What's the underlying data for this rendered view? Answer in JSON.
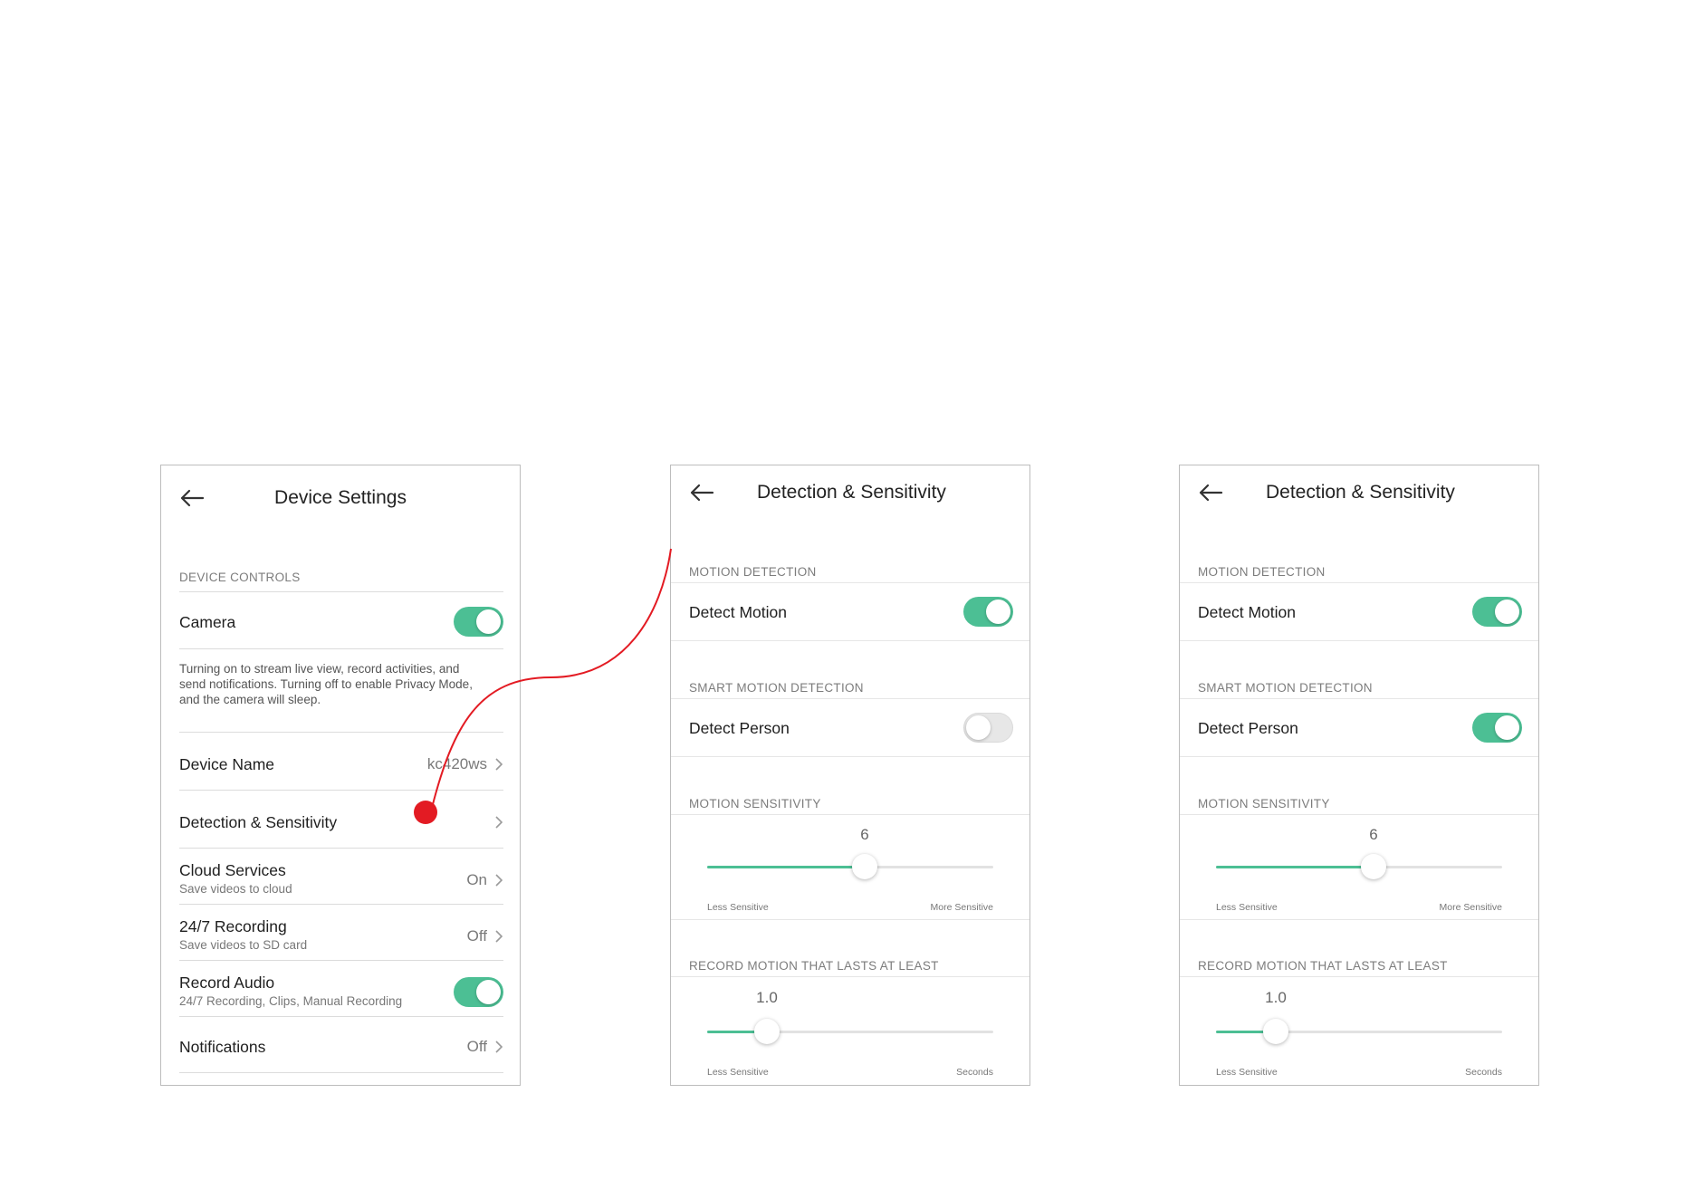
{
  "colors": {
    "accent": "#4cbf94",
    "connector": "#e31b23"
  },
  "settings_screen": {
    "title": "Device Settings",
    "back_icon": "arrow-left-icon",
    "section_device_controls": "DEVICE CONTROLS",
    "camera": {
      "label": "Camera",
      "enabled": true
    },
    "camera_description": "Turning on to stream live view, record activities, and send notifications. Turning off to enable Privacy Mode, and the camera will sleep.",
    "device_name": {
      "label": "Device Name",
      "value": "kc420ws"
    },
    "detection": {
      "label": "Detection & Sensitivity"
    },
    "cloud": {
      "label": "Cloud Services",
      "sub": "Save videos to cloud",
      "value": "On"
    },
    "recording": {
      "label": "24/7 Recording",
      "sub": "Save videos to SD card",
      "value": "Off"
    },
    "audio": {
      "label": "Record Audio",
      "sub": "24/7 Recording, Clips, Manual Recording",
      "enabled": true
    },
    "notifications": {
      "label": "Notifications",
      "value": "Off"
    }
  },
  "detection_screens": [
    {
      "title": "Detection & Sensitivity",
      "motion_section": "MOTION DETECTION",
      "detect_motion": {
        "label": "Detect Motion",
        "enabled": true
      },
      "smart_section": "SMART MOTION DETECTION",
      "detect_person": {
        "label": "Detect Person",
        "enabled": false
      },
      "sensitivity_section": "MOTION SENSITIVITY",
      "sensitivity": {
        "value": "6",
        "level_fraction": 0.55,
        "min_label": "Less Sensitive",
        "max_label": "More Sensitive"
      },
      "duration_section": "RECORD MOTION THAT LASTS AT LEAST",
      "duration": {
        "value": "1.0",
        "level_fraction": 0.21,
        "min_label": "Less Sensitive",
        "max_label": "Seconds"
      }
    },
    {
      "title": "Detection & Sensitivity",
      "motion_section": "MOTION DETECTION",
      "detect_motion": {
        "label": "Detect Motion",
        "enabled": true
      },
      "smart_section": "SMART MOTION DETECTION",
      "detect_person": {
        "label": "Detect Person",
        "enabled": true
      },
      "sensitivity_section": "MOTION SENSITIVITY",
      "sensitivity": {
        "value": "6",
        "level_fraction": 0.55,
        "min_label": "Less Sensitive",
        "max_label": "More Sensitive"
      },
      "duration_section": "RECORD MOTION THAT LASTS AT LEAST",
      "duration": {
        "value": "1.0",
        "level_fraction": 0.21,
        "min_label": "Less Sensitive",
        "max_label": "Seconds"
      }
    }
  ]
}
